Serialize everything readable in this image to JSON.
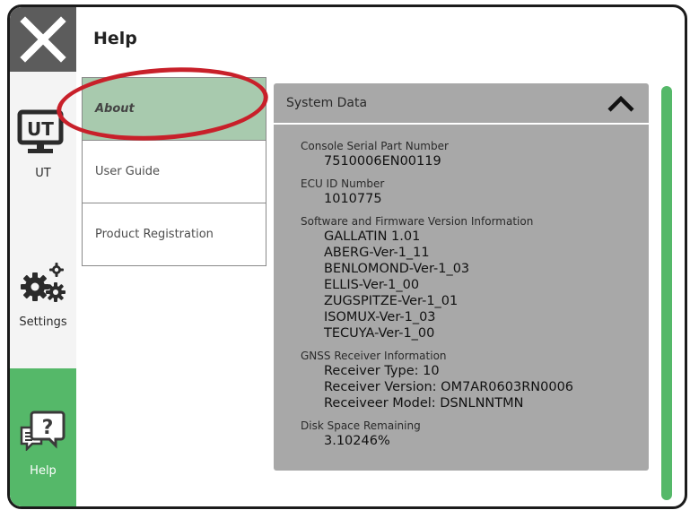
{
  "header": {
    "title": "Help"
  },
  "nav": {
    "ut_label": "UT",
    "ut_icon_text": "UT",
    "settings_label": "Settings",
    "help_label": "Help"
  },
  "menu": {
    "items": [
      {
        "label": "About",
        "active": true
      },
      {
        "label": "User Guide",
        "active": false
      },
      {
        "label": "Product Registration",
        "active": false
      }
    ]
  },
  "panel": {
    "title": "System Data",
    "sections": [
      {
        "heading": "Console Serial Part Number",
        "values": [
          "7510006EN00119"
        ]
      },
      {
        "heading": "ECU ID Number",
        "values": [
          "1010775"
        ]
      },
      {
        "heading": "Software and Firmware Version Information",
        "values": [
          "GALLATIN 1.01",
          "ABERG-Ver-1_11",
          "BENLOMOND-Ver-1_03",
          "ELLIS-Ver-1_00",
          "ZUGSPITZE-Ver-1_01",
          "ISOMUX-Ver-1_03",
          "TECUYA-Ver-1_00"
        ]
      },
      {
        "heading": "GNSS Receiver Information",
        "values": [
          "Receiver Type: 10",
          "Receiver Version: OM7AR0603RN0006",
          "Receiveer Model: DSNLNNTMN"
        ]
      },
      {
        "heading": "Disk Space Remaining",
        "values": [
          "3.10246%"
        ]
      }
    ]
  },
  "colors": {
    "accent_green": "#55b869",
    "highlight_red": "#c8202a",
    "panel_gray": "#a8a8a8",
    "active_menu": "#a8caae"
  },
  "icons": {
    "close": "close-x-icon",
    "ut": "ut-monitor-icon",
    "settings": "gears-icon",
    "help": "help-chat-icon",
    "collapse": "chevron-up-icon"
  }
}
